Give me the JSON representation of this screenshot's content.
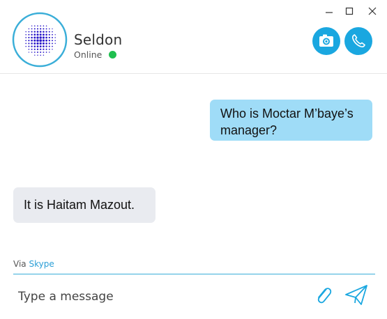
{
  "contact": {
    "name": "Seldon",
    "status": "Online",
    "status_color": "#1fbf4f",
    "avatar_icon": "dotted-sphere-icon"
  },
  "window_controls": {
    "minimize_icon": "minimize-icon",
    "maximize_icon": "maximize-icon",
    "close_icon": "close-icon"
  },
  "actions": {
    "camera_icon": "camera-icon",
    "call_icon": "phone-icon"
  },
  "messages": [
    {
      "direction": "outgoing",
      "text": "Who is Moctar M’baye’s manager?"
    },
    {
      "direction": "incoming",
      "text": "It is Haitam Mazout."
    }
  ],
  "footer": {
    "via_prefix": "Via",
    "via_link": "Skype",
    "input_placeholder": "Type a message",
    "attach_icon": "paperclip-icon",
    "send_icon": "send-icon"
  },
  "colors": {
    "accent": "#1aa7e0",
    "outgoing_bubble": "#9fdcf7",
    "incoming_bubble": "#e9ebf0",
    "avatar_ring": "#3aaed8",
    "avatar_dots": "#2a18c9",
    "link": "#2a9ed6"
  }
}
